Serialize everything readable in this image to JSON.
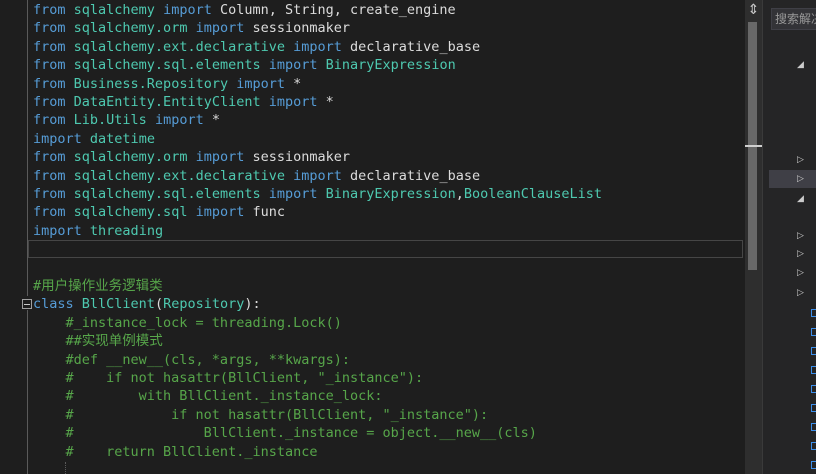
{
  "editor": {
    "lines": [
      [
        {
          "t": "kw",
          "v": "from"
        },
        {
          "t": "plain",
          "v": " "
        },
        {
          "t": "mod",
          "v": "sqlalchemy"
        },
        {
          "t": "plain",
          "v": " "
        },
        {
          "t": "kw",
          "v": "import"
        },
        {
          "t": "plain",
          "v": " Column, String, create_engine"
        }
      ],
      [
        {
          "t": "kw",
          "v": "from"
        },
        {
          "t": "plain",
          "v": " "
        },
        {
          "t": "mod",
          "v": "sqlalchemy.orm"
        },
        {
          "t": "plain",
          "v": " "
        },
        {
          "t": "kw",
          "v": "import"
        },
        {
          "t": "plain",
          "v": " sessionmaker"
        }
      ],
      [
        {
          "t": "kw",
          "v": "from"
        },
        {
          "t": "plain",
          "v": " "
        },
        {
          "t": "mod",
          "v": "sqlalchemy.ext.declarative"
        },
        {
          "t": "plain",
          "v": " "
        },
        {
          "t": "kw",
          "v": "import"
        },
        {
          "t": "plain",
          "v": " declarative_base"
        }
      ],
      [
        {
          "t": "kw",
          "v": "from"
        },
        {
          "t": "plain",
          "v": " "
        },
        {
          "t": "mod",
          "v": "sqlalchemy.sql.elements"
        },
        {
          "t": "plain",
          "v": " "
        },
        {
          "t": "kw",
          "v": "import"
        },
        {
          "t": "plain",
          "v": " "
        },
        {
          "t": "mod",
          "v": "BinaryExpression"
        }
      ],
      [
        {
          "t": "kw",
          "v": "from"
        },
        {
          "t": "plain",
          "v": " "
        },
        {
          "t": "mod",
          "v": "Business.Repository"
        },
        {
          "t": "plain",
          "v": " "
        },
        {
          "t": "kw",
          "v": "import"
        },
        {
          "t": "plain",
          "v": " *"
        }
      ],
      [
        {
          "t": "kw",
          "v": "from"
        },
        {
          "t": "plain",
          "v": " "
        },
        {
          "t": "mod",
          "v": "DataEntity.EntityClient"
        },
        {
          "t": "plain",
          "v": " "
        },
        {
          "t": "kw",
          "v": "import"
        },
        {
          "t": "plain",
          "v": " *"
        }
      ],
      [
        {
          "t": "kw",
          "v": "from"
        },
        {
          "t": "plain",
          "v": " "
        },
        {
          "t": "mod",
          "v": "Lib.Utils"
        },
        {
          "t": "plain",
          "v": " "
        },
        {
          "t": "kw",
          "v": "import"
        },
        {
          "t": "plain",
          "v": " *"
        }
      ],
      [
        {
          "t": "kw",
          "v": "import"
        },
        {
          "t": "plain",
          "v": " "
        },
        {
          "t": "mod",
          "v": "datetime"
        }
      ],
      [
        {
          "t": "kw",
          "v": "from"
        },
        {
          "t": "plain",
          "v": " "
        },
        {
          "t": "mod",
          "v": "sqlalchemy.orm"
        },
        {
          "t": "plain",
          "v": " "
        },
        {
          "t": "kw",
          "v": "import"
        },
        {
          "t": "plain",
          "v": " sessionmaker"
        }
      ],
      [
        {
          "t": "kw",
          "v": "from"
        },
        {
          "t": "plain",
          "v": " "
        },
        {
          "t": "mod",
          "v": "sqlalchemy.ext.declarative"
        },
        {
          "t": "plain",
          "v": " "
        },
        {
          "t": "kw",
          "v": "import"
        },
        {
          "t": "plain",
          "v": " declarative_base"
        }
      ],
      [
        {
          "t": "kw",
          "v": "from"
        },
        {
          "t": "plain",
          "v": " "
        },
        {
          "t": "mod",
          "v": "sqlalchemy.sql.elements"
        },
        {
          "t": "plain",
          "v": " "
        },
        {
          "t": "kw",
          "v": "import"
        },
        {
          "t": "plain",
          "v": " "
        },
        {
          "t": "mod",
          "v": "BinaryExpression"
        },
        {
          "t": "plain",
          "v": ","
        },
        {
          "t": "mod",
          "v": "BooleanClauseList"
        }
      ],
      [
        {
          "t": "kw",
          "v": "from"
        },
        {
          "t": "plain",
          "v": " "
        },
        {
          "t": "mod",
          "v": "sqlalchemy.sql"
        },
        {
          "t": "plain",
          "v": " "
        },
        {
          "t": "kw",
          "v": "import"
        },
        {
          "t": "plain",
          "v": " func"
        }
      ],
      [
        {
          "t": "kw",
          "v": "import"
        },
        {
          "t": "plain",
          "v": " "
        },
        {
          "t": "mod",
          "v": "threading"
        }
      ],
      [],
      [],
      [
        {
          "t": "comment",
          "v": "#用户操作业务逻辑类"
        }
      ],
      [
        {
          "t": "kw",
          "v": "class"
        },
        {
          "t": "plain",
          "v": " "
        },
        {
          "t": "mod",
          "v": "BllClient"
        },
        {
          "t": "plain",
          "v": "("
        },
        {
          "t": "mod",
          "v": "Repository"
        },
        {
          "t": "plain",
          "v": "):"
        }
      ],
      [
        {
          "t": "comment",
          "v": "    #_instance_lock = threading.Lock()"
        }
      ],
      [
        {
          "t": "comment",
          "v": "    ##实现单例模式"
        }
      ],
      [
        {
          "t": "comment",
          "v": "    #def __new__(cls, *args, **kwargs):"
        }
      ],
      [
        {
          "t": "comment",
          "v": "    #    if not hasattr(BllClient, \"_instance\"):"
        }
      ],
      [
        {
          "t": "comment",
          "v": "    #        with BllClient._instance_lock:"
        }
      ],
      [
        {
          "t": "comment",
          "v": "    #            if not hasattr(BllClient, \"_instance\"):"
        }
      ],
      [
        {
          "t": "comment",
          "v": "    #                BllClient._instance = object.__new__(cls)"
        }
      ],
      [
        {
          "t": "comment",
          "v": "    #    return BllClient._instance"
        }
      ]
    ]
  },
  "scrollbar": {
    "split_icon": "split-icon",
    "split_glyph": "⇕"
  },
  "side_panel": {
    "search_placeholder": "搜索解决方案",
    "arrow_collapsed_glyph": "▷",
    "arrow_expanded_glyph": "◢",
    "item_icon": "file-icon"
  },
  "colors": {
    "keyword": "#569cd6",
    "type": "#4ec9b0",
    "plain": "#dcdcdc",
    "comment": "#57a64a",
    "background": "#1e1e1e"
  }
}
